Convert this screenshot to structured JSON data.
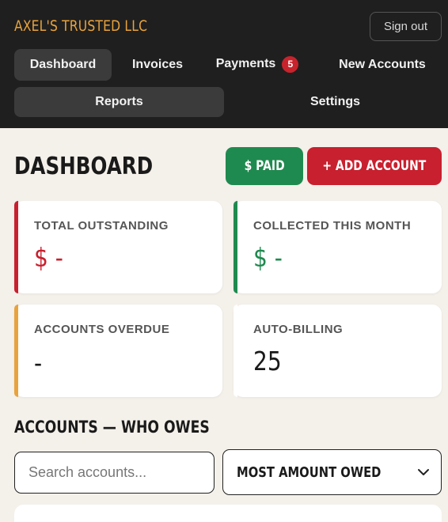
{
  "header": {
    "brand": "AXEL'S TRUSTED LLC",
    "sign_out": "Sign out"
  },
  "nav": {
    "tabs": [
      {
        "label": "Dashboard",
        "active": true
      },
      {
        "label": "Invoices",
        "active": false
      },
      {
        "label": "Payments",
        "active": false,
        "badge": "5"
      },
      {
        "label": "New Accounts",
        "active": false
      },
      {
        "label": "Reports",
        "active": true
      },
      {
        "label": "Settings",
        "active": false
      }
    ]
  },
  "page": {
    "title": "DASHBOARD",
    "paid_button": "$ PAID",
    "add_button": "+ ADD ACCOUNT"
  },
  "stats": [
    {
      "label": "TOTAL OUTSTANDING",
      "value": "$ -",
      "accent": "#c8202e",
      "value_color": "#c8202e"
    },
    {
      "label": "COLLECTED THIS MONTH",
      "value": "$ -",
      "accent": "#1f8a4f",
      "value_color": "#1f8a4f"
    },
    {
      "label": "ACCOUNTS OVERDUE",
      "value": "-",
      "accent": "#e8a33d",
      "value_color": "#1a1a1a"
    },
    {
      "label": "AUTO-BILLING",
      "value": "25",
      "accent": "#ffffff",
      "value_color": "#1a1a1a"
    }
  ],
  "accounts": {
    "title": "ACCOUNTS — WHO OWES",
    "search_placeholder": "Search accounts...",
    "sort_selected": "MOST AMOUNT OWED"
  },
  "colors": {
    "topbar": "#1f1f1f",
    "brand": "#e8a33d",
    "green": "#1f8a4f",
    "red": "#c8202e",
    "background": "#f4f0ea"
  }
}
